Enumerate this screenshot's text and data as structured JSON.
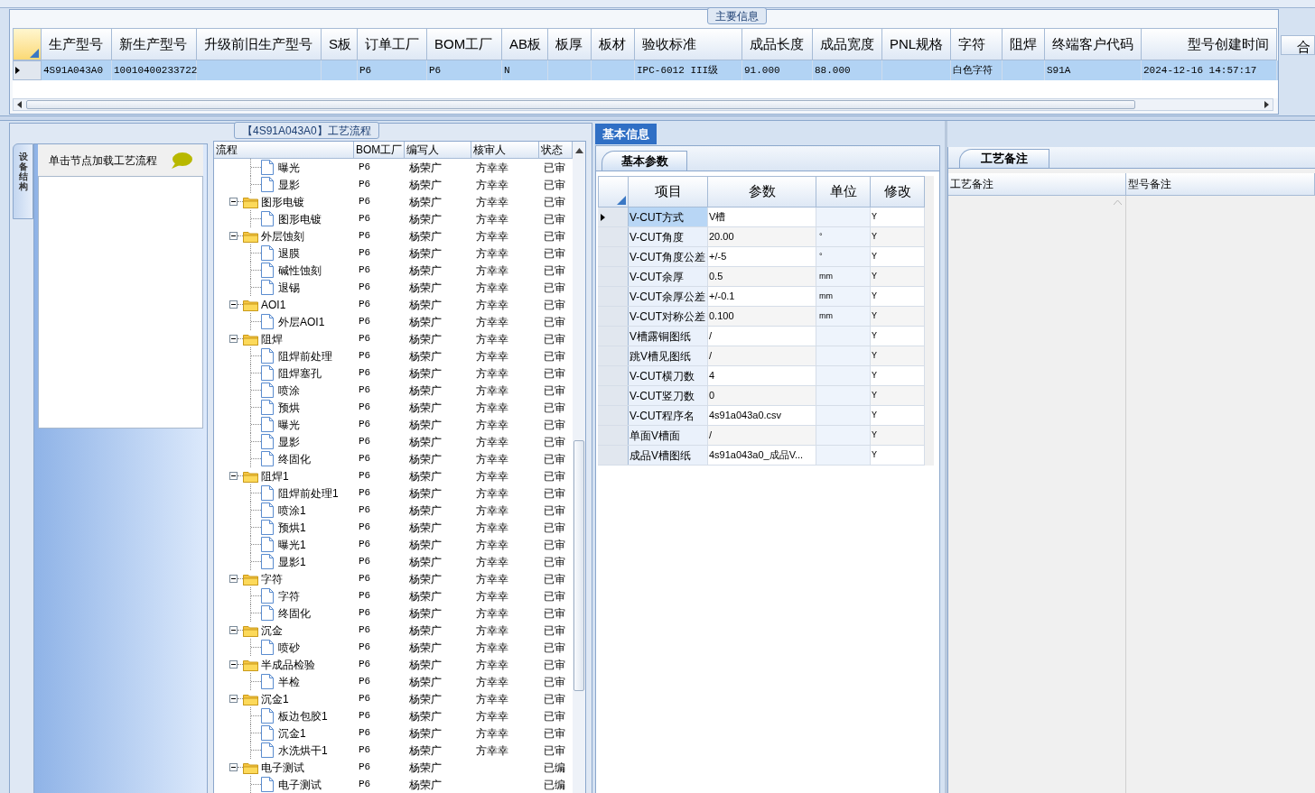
{
  "main_info": {
    "legend": "主要信息",
    "columns": [
      "生产型号",
      "新生产型号",
      "升级前旧生产型号",
      "S板",
      "订单工厂",
      "BOM工厂",
      "AB板",
      "板厚",
      "板材",
      "验收标准",
      "成品长度",
      "成品宽度",
      "PNL规格",
      "字符",
      "阻焊",
      "终端客户代码",
      "型号创建时间"
    ],
    "rows": [
      {
        "selected": true,
        "cells": [
          "4S91A043A0",
          "10010400233722",
          null,
          null,
          "P6",
          "P6",
          "N",
          null,
          null,
          "IPC-6012 III级",
          "91.000",
          "88.000",
          null,
          "白色字符",
          null,
          "S91A",
          "2024-12-16 14:57:17"
        ]
      }
    ],
    "cut_column": "合"
  },
  "process": {
    "title": "【4S91A043A0】工艺流程",
    "side_tab": "设备结构",
    "hint": "单击节点加载工艺流程",
    "columns": [
      "流程",
      "BOM工厂",
      "编写人",
      "核审人",
      "状态"
    ],
    "tree": [
      {
        "kind": "leaf",
        "name": "曝光",
        "bom": "P6",
        "writer": "杨荣广",
        "reviewer": "方幸幸",
        "status": "已审"
      },
      {
        "kind": "leaf",
        "name": "显影",
        "bom": "P6",
        "writer": "杨荣广",
        "reviewer": "方幸幸",
        "status": "已审"
      },
      {
        "kind": "folder",
        "name": "图形电镀",
        "expanded": true,
        "bom": "P6",
        "writer": "杨荣广",
        "reviewer": "方幸幸",
        "status": "已审",
        "children": [
          {
            "kind": "leaf",
            "name": "图形电镀",
            "bom": "P6",
            "writer": "杨荣广",
            "reviewer": "方幸幸",
            "status": "已审"
          }
        ]
      },
      {
        "kind": "folder",
        "name": "外层蚀刻",
        "expanded": true,
        "bom": "P6",
        "writer": "杨荣广",
        "reviewer": "方幸幸",
        "status": "已审",
        "children": [
          {
            "kind": "leaf",
            "name": "退膜",
            "bom": "P6",
            "writer": "杨荣广",
            "reviewer": "方幸幸",
            "status": "已审"
          },
          {
            "kind": "leaf",
            "name": "碱性蚀刻",
            "bom": "P6",
            "writer": "杨荣广",
            "reviewer": "方幸幸",
            "status": "已审"
          },
          {
            "kind": "leaf",
            "name": "退锡",
            "bom": "P6",
            "writer": "杨荣广",
            "reviewer": "方幸幸",
            "status": "已审"
          }
        ]
      },
      {
        "kind": "folder",
        "name": "AOI1",
        "expanded": true,
        "bom": "P6",
        "writer": "杨荣广",
        "reviewer": "方幸幸",
        "status": "已审",
        "children": [
          {
            "kind": "leaf",
            "name": "外层AOI1",
            "bom": "P6",
            "writer": "杨荣广",
            "reviewer": "方幸幸",
            "status": "已审"
          }
        ]
      },
      {
        "kind": "folder",
        "name": "阻焊",
        "expanded": true,
        "bom": "P6",
        "writer": "杨荣广",
        "reviewer": "方幸幸",
        "status": "已审",
        "children": [
          {
            "kind": "leaf",
            "name": "阻焊前处理",
            "bom": "P6",
            "writer": "杨荣广",
            "reviewer": "方幸幸",
            "status": "已审"
          },
          {
            "kind": "leaf",
            "name": "阻焊塞孔",
            "bom": "P6",
            "writer": "杨荣广",
            "reviewer": "方幸幸",
            "status": "已审"
          },
          {
            "kind": "leaf",
            "name": "喷涂",
            "bom": "P6",
            "writer": "杨荣广",
            "reviewer": "方幸幸",
            "status": "已审"
          },
          {
            "kind": "leaf",
            "name": "预烘",
            "bom": "P6",
            "writer": "杨荣广",
            "reviewer": "方幸幸",
            "status": "已审"
          },
          {
            "kind": "leaf",
            "name": "曝光",
            "bom": "P6",
            "writer": "杨荣广",
            "reviewer": "方幸幸",
            "status": "已审"
          },
          {
            "kind": "leaf",
            "name": "显影",
            "bom": "P6",
            "writer": "杨荣广",
            "reviewer": "方幸幸",
            "status": "已审"
          },
          {
            "kind": "leaf",
            "name": "终固化",
            "bom": "P6",
            "writer": "杨荣广",
            "reviewer": "方幸幸",
            "status": "已审"
          }
        ]
      },
      {
        "kind": "folder",
        "name": "阻焊1",
        "expanded": true,
        "bom": "P6",
        "writer": "杨荣广",
        "reviewer": "方幸幸",
        "status": "已审",
        "children": [
          {
            "kind": "leaf",
            "name": "阻焊前处理1",
            "bom": "P6",
            "writer": "杨荣广",
            "reviewer": "方幸幸",
            "status": "已审"
          },
          {
            "kind": "leaf",
            "name": "喷涂1",
            "bom": "P6",
            "writer": "杨荣广",
            "reviewer": "方幸幸",
            "status": "已审"
          },
          {
            "kind": "leaf",
            "name": "预烘1",
            "bom": "P6",
            "writer": "杨荣广",
            "reviewer": "方幸幸",
            "status": "已审"
          },
          {
            "kind": "leaf",
            "name": "曝光1",
            "bom": "P6",
            "writer": "杨荣广",
            "reviewer": "方幸幸",
            "status": "已审"
          },
          {
            "kind": "leaf",
            "name": "显影1",
            "bom": "P6",
            "writer": "杨荣广",
            "reviewer": "方幸幸",
            "status": "已审"
          }
        ]
      },
      {
        "kind": "folder",
        "name": "字符",
        "expanded": true,
        "bom": "P6",
        "writer": "杨荣广",
        "reviewer": "方幸幸",
        "status": "已审",
        "children": [
          {
            "kind": "leaf",
            "name": "字符",
            "bom": "P6",
            "writer": "杨荣广",
            "reviewer": "方幸幸",
            "status": "已审"
          },
          {
            "kind": "leaf",
            "name": "终固化",
            "bom": "P6",
            "writer": "杨荣广",
            "reviewer": "方幸幸",
            "status": "已审"
          }
        ]
      },
      {
        "kind": "folder",
        "name": "沉金",
        "expanded": true,
        "bom": "P6",
        "writer": "杨荣广",
        "reviewer": "方幸幸",
        "status": "已审",
        "children": [
          {
            "kind": "leaf",
            "name": "喷砂",
            "bom": "P6",
            "writer": "杨荣广",
            "reviewer": "方幸幸",
            "status": "已审"
          }
        ]
      },
      {
        "kind": "folder",
        "name": "半成品检验",
        "expanded": true,
        "bom": "P6",
        "writer": "杨荣广",
        "reviewer": "方幸幸",
        "status": "已审",
        "children": [
          {
            "kind": "leaf",
            "name": "半检",
            "bom": "P6",
            "writer": "杨荣广",
            "reviewer": "方幸幸",
            "status": "已审"
          }
        ]
      },
      {
        "kind": "folder",
        "name": "沉金1",
        "expanded": true,
        "bom": "P6",
        "writer": "杨荣广",
        "reviewer": "方幸幸",
        "status": "已审",
        "children": [
          {
            "kind": "leaf",
            "name": "板边包胶1",
            "bom": "P6",
            "writer": "杨荣广",
            "reviewer": "方幸幸",
            "status": "已审"
          },
          {
            "kind": "leaf",
            "name": "沉金1",
            "bom": "P6",
            "writer": "杨荣广",
            "reviewer": "方幸幸",
            "status": "已审"
          },
          {
            "kind": "leaf",
            "name": "水洗烘干1",
            "bom": "P6",
            "writer": "杨荣广",
            "reviewer": "方幸幸",
            "status": "已审"
          }
        ]
      },
      {
        "kind": "folder",
        "name": "电子测试",
        "expanded": true,
        "bom": "P6",
        "writer": "杨荣广",
        "status": "已编",
        "children": [
          {
            "kind": "leaf",
            "name": "电子测试",
            "bom": "P6",
            "writer": "杨荣广",
            "status": "已编"
          }
        ]
      }
    ]
  },
  "basic_info": {
    "tabs": [
      {
        "label": "基本信息",
        "selected": true
      }
    ],
    "subtab": "基本参数",
    "columns": [
      "项目",
      "参数",
      "单位",
      "修改"
    ],
    "rows": [
      {
        "selected": true,
        "item": "V-CUT方式",
        "param": "V槽",
        "modify": "Y"
      },
      {
        "selected": false,
        "item": "V-CUT角度",
        "param": "20.00",
        "unit": "°",
        "modify": "Y"
      },
      {
        "selected": false,
        "item": "V-CUT角度公差",
        "param": "+/-5",
        "unit": "°",
        "modify": "Y"
      },
      {
        "selected": false,
        "item": "V-CUT余厚",
        "param": "0.5",
        "unit": "mm",
        "modify": "Y"
      },
      {
        "selected": false,
        "item": "V-CUT余厚公差",
        "param": "+/-0.1",
        "unit": "mm",
        "modify": "Y"
      },
      {
        "selected": false,
        "item": "V-CUT对称公差",
        "param": "0.100",
        "unit": "mm",
        "modify": "Y"
      },
      {
        "selected": false,
        "item": "V槽露铜图纸",
        "param": "/",
        "modify": "Y"
      },
      {
        "selected": false,
        "item": "跳V槽见图纸",
        "param": "/",
        "modify": "Y"
      },
      {
        "selected": false,
        "item": "V-CUT横刀数",
        "param": "4",
        "modify": "Y"
      },
      {
        "selected": false,
        "item": "V-CUT竖刀数",
        "param": "0",
        "modify": "Y"
      },
      {
        "selected": false,
        "item": "V-CUT程序名",
        "param": "4s91a043a0.csv",
        "modify": "Y"
      },
      {
        "selected": false,
        "item": "单面V槽面",
        "param": "/",
        "modify": "Y"
      },
      {
        "selected": false,
        "item": "成品V槽图纸",
        "param": "4s91a043a0_成品V...",
        "modify": "Y"
      }
    ]
  },
  "notes": {
    "tab": "工艺备注",
    "columns": [
      "工艺备注",
      "型号备注"
    ]
  }
}
